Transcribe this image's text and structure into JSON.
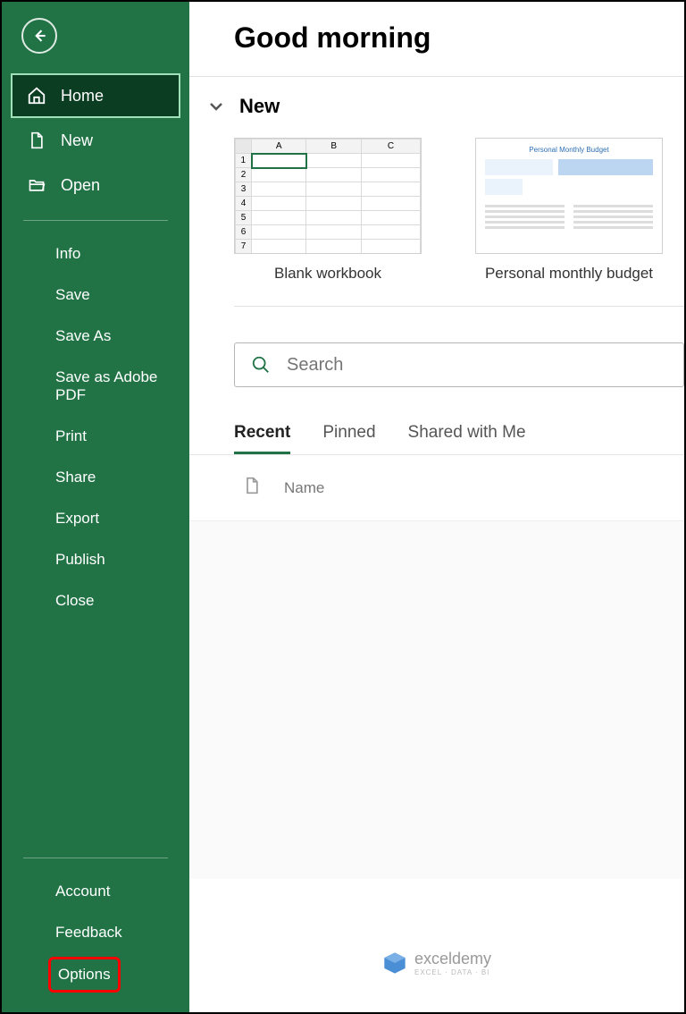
{
  "sidebar": {
    "primary": [
      {
        "label": "Home"
      },
      {
        "label": "New"
      },
      {
        "label": "Open"
      }
    ],
    "secondary": [
      {
        "label": "Info"
      },
      {
        "label": "Save"
      },
      {
        "label": "Save As"
      },
      {
        "label": "Save as Adobe PDF"
      },
      {
        "label": "Print"
      },
      {
        "label": "Share"
      },
      {
        "label": "Export"
      },
      {
        "label": "Publish"
      },
      {
        "label": "Close"
      }
    ],
    "bottom": [
      {
        "label": "Account"
      },
      {
        "label": "Feedback"
      },
      {
        "label": "Options"
      }
    ]
  },
  "main": {
    "greeting": "Good morning",
    "new_section_label": "New",
    "templates": [
      {
        "label": "Blank workbook"
      },
      {
        "label": "Personal monthly budget"
      }
    ],
    "blank_thumb": {
      "cols": [
        "A",
        "B",
        "C"
      ],
      "rows": [
        "1",
        "2",
        "3",
        "4",
        "5",
        "6",
        "7"
      ]
    },
    "budget_thumb_title": "Personal Monthly Budget",
    "search_placeholder": "Search",
    "tabs": [
      {
        "label": "Recent"
      },
      {
        "label": "Pinned"
      },
      {
        "label": "Shared with Me"
      }
    ],
    "list_cols": {
      "name": "Name"
    }
  },
  "watermark": {
    "brand": "exceldemy",
    "tagline": "EXCEL · DATA · BI"
  }
}
